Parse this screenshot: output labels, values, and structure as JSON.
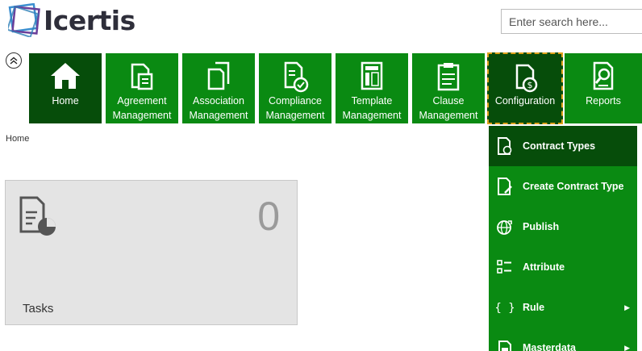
{
  "brand": {
    "name": "Icertis"
  },
  "search": {
    "placeholder": "Enter search here..."
  },
  "nav": {
    "tiles": [
      {
        "label": "Home",
        "icon": "home-icon"
      },
      {
        "label": "Agreement\nManagement",
        "icon": "agreement-document-icon"
      },
      {
        "label": "Association\nManagement",
        "icon": "association-documents-icon"
      },
      {
        "label": "Compliance\nManagement",
        "icon": "compliance-document-icon"
      },
      {
        "label": "Template\nManagement",
        "icon": "template-icon"
      },
      {
        "label": "Clause\nManagement",
        "icon": "clipboard-icon"
      },
      {
        "label": "Configuration",
        "icon": "configuration-document-icon"
      },
      {
        "label": "Reports",
        "icon": "reports-icon"
      }
    ]
  },
  "breadcrumb": {
    "home": "Home"
  },
  "tasks_card": {
    "count": "0",
    "label": "Tasks"
  },
  "config_menu": {
    "items": [
      {
        "label": "Contract Types",
        "icon": "contract-types-icon"
      },
      {
        "label": "Create Contract Type",
        "icon": "create-contract-type-icon"
      },
      {
        "label": "Publish",
        "icon": "publish-globe-icon"
      },
      {
        "label": "Attribute",
        "icon": "attribute-list-icon"
      },
      {
        "label": "Rule",
        "icon": "rule-braces-icon",
        "submenu": "▶"
      },
      {
        "label": "Masterdata",
        "icon": "masterdata-icon",
        "submenu": "▶"
      }
    ]
  },
  "colors": {
    "tile_green": "#0a8a12",
    "tile_dark_green": "#064d0a",
    "selection_outline": "#e0a21a",
    "card_bg": "#e4e4e4"
  }
}
